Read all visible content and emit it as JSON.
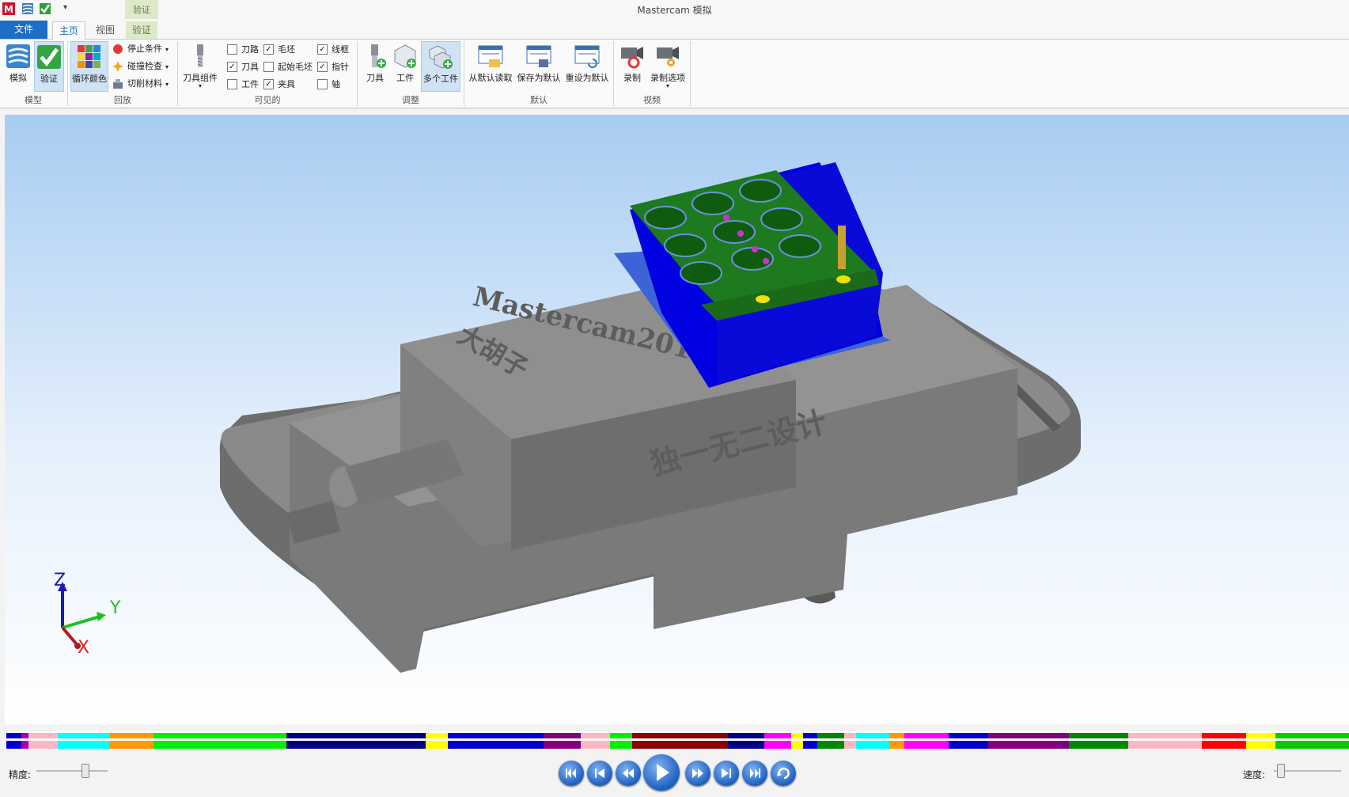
{
  "window": {
    "title": "Mastercam 模拟"
  },
  "context_group": {
    "label": "验证"
  },
  "tabs": {
    "file": "文件",
    "home": "主页",
    "view": "视图",
    "verify": "验证"
  },
  "ribbon": {
    "model": {
      "label": "模型",
      "simulate": "模拟",
      "verify": "验证"
    },
    "playback": {
      "label": "回放",
      "cycle_color": "循环颜色",
      "stop_condition": "停止条件",
      "collision_check": "碰撞检查",
      "cut_material": "切削材料"
    },
    "visible": {
      "label": "可见的",
      "tool_assembly": "刀具组件",
      "toolpath": {
        "label": "刀路",
        "checked": false
      },
      "stock": {
        "label": "毛坯",
        "checked": true
      },
      "wireframe": {
        "label": "线框",
        "checked": true
      },
      "tool": {
        "label": "刀具",
        "checked": true
      },
      "initial_stock": {
        "label": "起始毛坯",
        "checked": false
      },
      "pointer": {
        "label": "指针",
        "checked": true
      },
      "workpiece": {
        "label": "工件",
        "checked": false
      },
      "fixture": {
        "label": "夹具",
        "checked": true
      },
      "axis": {
        "label": "轴",
        "checked": false
      }
    },
    "adjust": {
      "label": "调整",
      "tool": "刀具",
      "workpiece": "工件",
      "multi_workpiece": "多个工件"
    },
    "defaults": {
      "label": "默认",
      "read_default": "从默认读取",
      "save_default": "保存为默认",
      "reset_default": "重设为默认"
    },
    "video": {
      "label": "视频",
      "record": "录制",
      "record_options": "录制选项"
    }
  },
  "viewport": {
    "engraving_top": "Mastercam2018",
    "engraving_side": "独一无二设计",
    "engraving_left": "大胡子",
    "axes": {
      "z": "Z",
      "y": "Y",
      "x": "X"
    }
  },
  "timeline": {
    "segments": [
      {
        "color": "#0000cc",
        "w": 1.0
      },
      {
        "color": "#aa00aa",
        "w": 0.5
      },
      {
        "color": "#ffb6c1",
        "w": 2.0
      },
      {
        "color": "#00ffff",
        "w": 3.5
      },
      {
        "color": "#ff9900",
        "w": 3.0
      },
      {
        "color": "#00ee00",
        "w": 9.0
      },
      {
        "color": "#000080",
        "w": 9.5
      },
      {
        "color": "#ffff00",
        "w": 1.5
      },
      {
        "color": "#0000cc",
        "w": 6.5
      },
      {
        "color": "#800080",
        "w": 2.5
      },
      {
        "color": "#ffb6c1",
        "w": 2.0
      },
      {
        "color": "#00ee00",
        "w": 1.5
      },
      {
        "color": "#8b0000",
        "w": 6.5
      },
      {
        "color": "#000080",
        "w": 2.5
      },
      {
        "color": "#ff00ff",
        "w": 1.8
      },
      {
        "color": "#ffff00",
        "w": 0.8
      },
      {
        "color": "#0000cc",
        "w": 1.0
      },
      {
        "color": "#008800",
        "w": 1.8
      },
      {
        "color": "#ffb6c1",
        "w": 0.8
      },
      {
        "color": "#00ffff",
        "w": 2.3
      },
      {
        "color": "#ff9900",
        "w": 1.0
      },
      {
        "color": "#ff00ff",
        "w": 3.0
      },
      {
        "color": "#0000cc",
        "w": 2.7
      },
      {
        "color": "#800080",
        "w": 5.5
      },
      {
        "color": "#008800",
        "w": 4.0
      },
      {
        "color": "#ffb6c1",
        "w": 5.0
      },
      {
        "color": "#ff0000",
        "w": 3.0
      },
      {
        "color": "#ffff00",
        "w": 2.0
      },
      {
        "color": "#00cc00",
        "w": 5.0
      }
    ]
  },
  "playback_bar": {
    "precision_label": "精度:",
    "speed_label": "速度:",
    "precision_level": 0.7,
    "speed_level": 0.05
  }
}
